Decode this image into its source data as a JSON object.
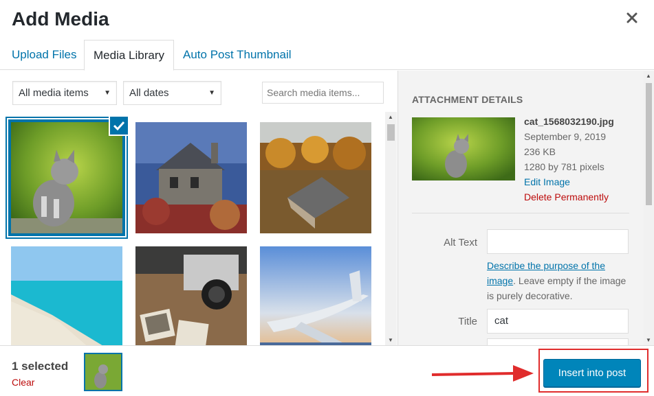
{
  "modal": {
    "title": "Add Media"
  },
  "tabs": [
    {
      "label": "Upload Files"
    },
    {
      "label": "Media Library"
    },
    {
      "label": "Auto Post Thumbnail"
    }
  ],
  "filters": {
    "type": "All media items",
    "date": "All dates",
    "search_placeholder": "Search media items..."
  },
  "details": {
    "heading": "ATTACHMENT DETAILS",
    "filename": "cat_1568032190.jpg",
    "date": "September 9, 2019",
    "size": "236 KB",
    "dimensions": "1280 by 781 pixels",
    "edit_link": "Edit Image",
    "delete_link": "Delete Permanently",
    "alt_label": "Alt Text",
    "alt_value": "",
    "alt_help_link": "Describe the purpose of the image",
    "alt_help_rest": ". Leave empty if the image is purely decorative.",
    "title_label": "Title",
    "title_value": "cat"
  },
  "footer": {
    "selected": "1 selected",
    "clear": "Clear",
    "insert": "Insert into post"
  },
  "colors": {
    "accent": "#0073aa",
    "button": "#0085ba",
    "danger": "#bc0b0b",
    "annotation": "#e02c2c"
  },
  "icons": {
    "close": "close-icon",
    "check": "checkmark-icon",
    "arrow": "red-arrow-annotation"
  }
}
